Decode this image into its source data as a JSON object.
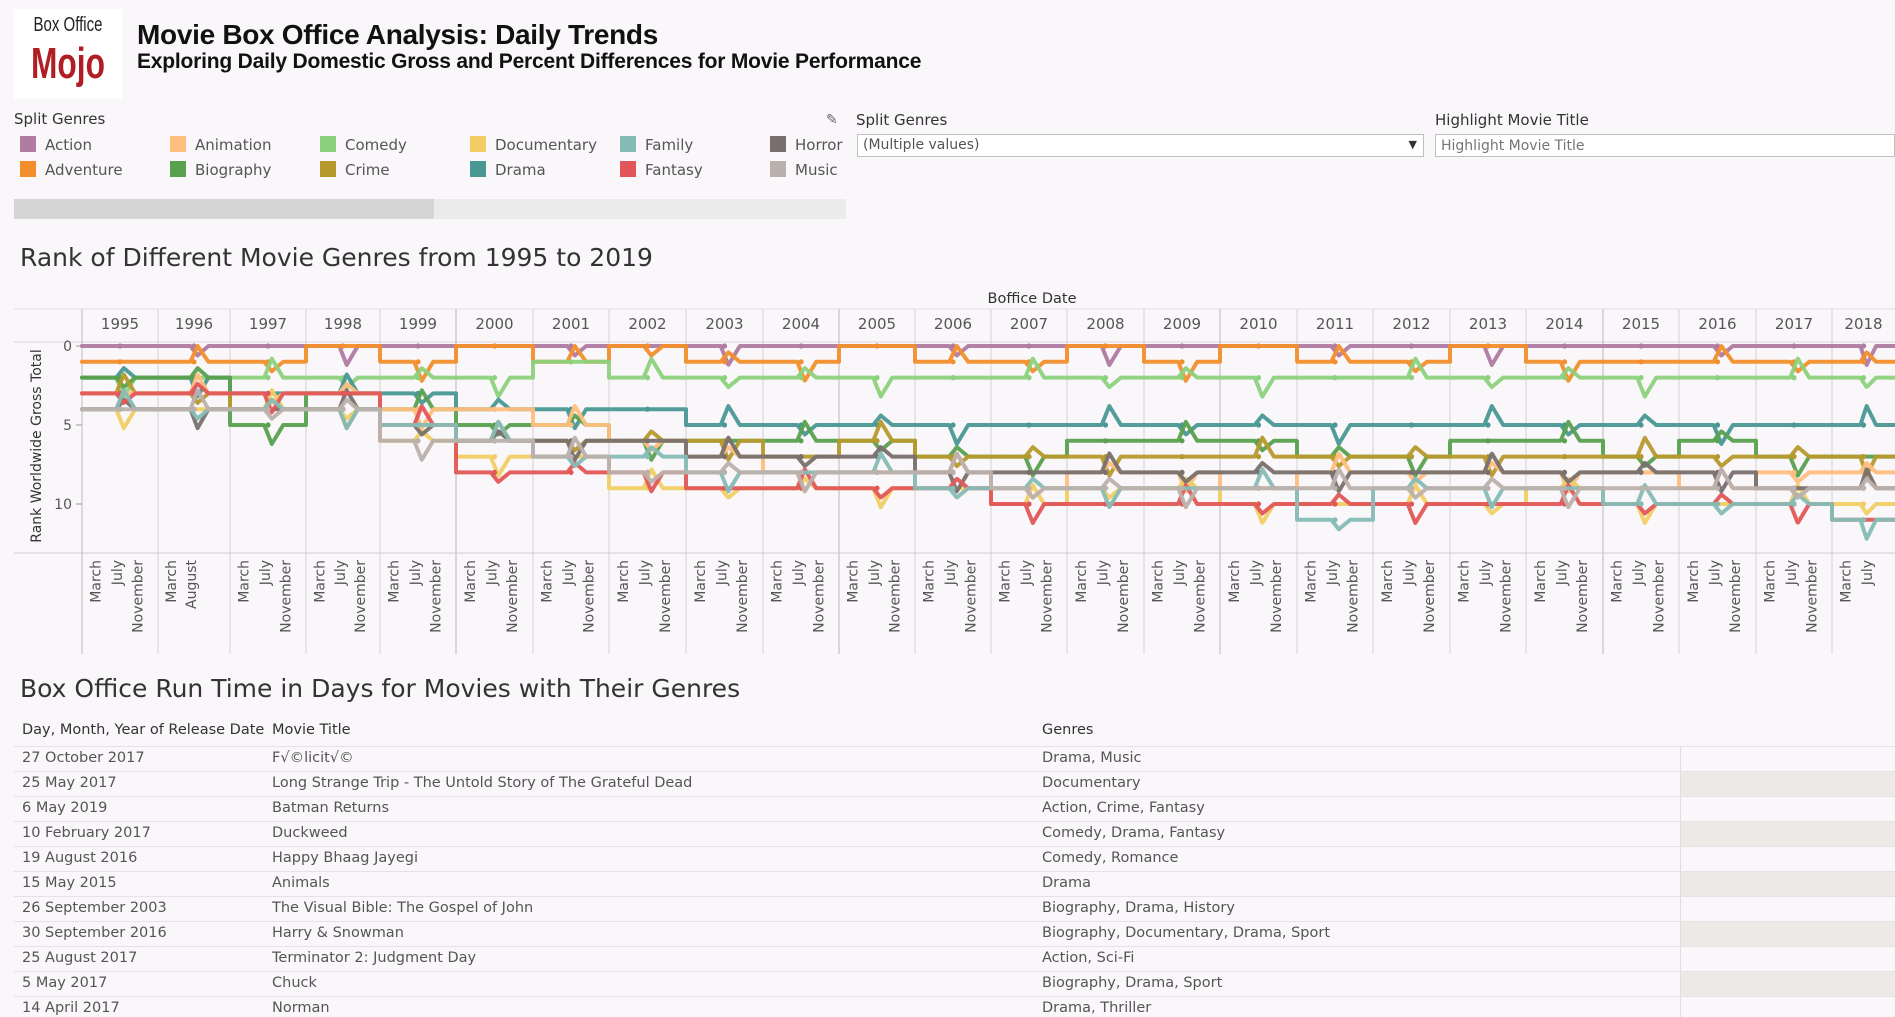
{
  "header": {
    "logo_line1": "Box Office",
    "logo_line2": "Mojo",
    "title": "Movie Box Office Analysis: Daily Trends",
    "subtitle": "Exploring Daily Domestic Gross and Percent Differences for Movie Performance"
  },
  "legend": {
    "title": "Split Genres",
    "items": [
      {
        "label": "Action",
        "color": "#b07aa1"
      },
      {
        "label": "Adventure",
        "color": "#f28e2b"
      },
      {
        "label": "Animation",
        "color": "#ffbe7d"
      },
      {
        "label": "Biography",
        "color": "#59a14f"
      },
      {
        "label": "Comedy",
        "color": "#8cd17d"
      },
      {
        "label": "Crime",
        "color": "#b6992d"
      },
      {
        "label": "Documentary",
        "color": "#f1ce63"
      },
      {
        "label": "Drama",
        "color": "#499894"
      },
      {
        "label": "Family",
        "color": "#86bcb6"
      },
      {
        "label": "Fantasy",
        "color": "#e15759"
      },
      {
        "label": "Horror",
        "color": "#79706e"
      },
      {
        "label": "Music",
        "color": "#bab0ac"
      }
    ]
  },
  "filters": {
    "genres_label": "Split Genres",
    "genres_value": "(Multiple values)",
    "title_label": "Highlight Movie Title",
    "title_placeholder": "Highlight Movie Title"
  },
  "chart": {
    "title": "Rank of Different Movie Genres from 1995 to 2019"
  },
  "chart_data": {
    "type": "line",
    "title": "Rank of Different Movie Genres from 1995 to 2019",
    "xlabel": "Boffice Date",
    "ylabel": "Rank Worldwide Gross Total",
    "ylim": [
      0,
      13
    ],
    "yticks": [
      0,
      5,
      10
    ],
    "y_reversed": true,
    "years": [
      "1995",
      "1996",
      "1997",
      "1998",
      "1999",
      "2000",
      "2001",
      "2002",
      "2003",
      "2004",
      "2005",
      "2006",
      "2007",
      "2008",
      "2009",
      "2010",
      "2011",
      "2012",
      "2013",
      "2014",
      "2015",
      "2016",
      "2017",
      "2018"
    ],
    "month_ticks": {
      "1995": [
        "March",
        "July",
        "November"
      ],
      "1996": [
        "March",
        "August"
      ],
      "1997": [
        "March",
        "July",
        "November"
      ],
      "1998": [
        "March",
        "July",
        "November"
      ],
      "1999": [
        "March",
        "July",
        "November"
      ],
      "2000": [
        "March",
        "July",
        "November"
      ],
      "2001": [
        "March",
        "July",
        "November"
      ],
      "2002": [
        "March",
        "July",
        "November"
      ],
      "2003": [
        "March",
        "July",
        "November"
      ],
      "2004": [
        "March",
        "July",
        "November"
      ],
      "2005": [
        "March",
        "July",
        "November"
      ],
      "2006": [
        "March",
        "July",
        "November"
      ],
      "2007": [
        "March",
        "July",
        "November"
      ],
      "2008": [
        "March",
        "July",
        "November"
      ],
      "2009": [
        "March",
        "July",
        "November"
      ],
      "2010": [
        "March",
        "July",
        "November"
      ],
      "2011": [
        "March",
        "July",
        "November"
      ],
      "2012": [
        "March",
        "July",
        "November"
      ],
      "2013": [
        "March",
        "July",
        "November"
      ],
      "2014": [
        "March",
        "July",
        "November"
      ],
      "2015": [
        "March",
        "July",
        "November"
      ],
      "2016": [
        "March",
        "July",
        "November"
      ],
      "2017": [
        "March",
        "July",
        "November"
      ],
      "2018": [
        "March",
        "July"
      ]
    },
    "series": [
      {
        "name": "Action",
        "color": "#b07aa1",
        "values": [
          0,
          0,
          0,
          0,
          0,
          0,
          0,
          0,
          0,
          0,
          0,
          0,
          0,
          0,
          0,
          0,
          0,
          0,
          0,
          0,
          0,
          0,
          0,
          0
        ]
      },
      {
        "name": "Adventure",
        "color": "#f28e2b",
        "values": [
          1,
          1,
          1,
          0,
          1,
          0,
          1,
          0,
          1,
          1,
          0,
          1,
          1,
          0,
          1,
          0,
          1,
          1,
          0,
          1,
          1,
          1,
          1,
          1
        ]
      },
      {
        "name": "Comedy",
        "color": "#8cd17d",
        "values": [
          2,
          2,
          2,
          2,
          2,
          2,
          1,
          2,
          2,
          2,
          2,
          2,
          2,
          2,
          2,
          2,
          2,
          2,
          2,
          2,
          2,
          2,
          2,
          2
        ]
      },
      {
        "name": "Drama",
        "color": "#499894",
        "values": [
          2,
          2,
          3,
          3,
          3,
          4,
          4,
          4,
          5,
          5,
          5,
          5,
          5,
          5,
          5,
          5,
          5,
          5,
          5,
          5,
          5,
          5,
          5,
          5
        ]
      },
      {
        "name": "Biography",
        "color": "#59a14f",
        "values": [
          2,
          2,
          5,
          3,
          4,
          5,
          5,
          6,
          6,
          6,
          6,
          7,
          7,
          6,
          6,
          6,
          7,
          7,
          6,
          6,
          7,
          6,
          7,
          7
        ]
      },
      {
        "name": "Crime",
        "color": "#b6992d",
        "values": [
          3,
          3,
          4,
          4,
          5,
          6,
          6,
          6,
          6,
          7,
          6,
          7,
          7,
          7,
          7,
          7,
          7,
          7,
          7,
          7,
          7,
          7,
          7,
          7
        ]
      },
      {
        "name": "Animation",
        "color": "#ffbe7d",
        "values": [
          3,
          3,
          3,
          3,
          4,
          4,
          5,
          6,
          7,
          8,
          8,
          8,
          9,
          8,
          8,
          9,
          8,
          8,
          8,
          8,
          8,
          9,
          8,
          8
        ]
      },
      {
        "name": "Documentary",
        "color": "#f1ce63",
        "values": [
          4,
          4,
          4,
          4,
          6,
          7,
          7,
          9,
          9,
          9,
          9,
          9,
          10,
          9,
          9,
          10,
          10,
          10,
          10,
          9,
          10,
          10,
          10,
          10
        ]
      },
      {
        "name": "Horror",
        "color": "#79706e",
        "values": [
          4,
          4,
          4,
          4,
          5,
          6,
          6,
          6,
          7,
          7,
          7,
          8,
          8,
          8,
          8,
          8,
          8,
          8,
          8,
          8,
          8,
          8,
          9,
          9
        ]
      },
      {
        "name": "Fantasy",
        "color": "#e15759",
        "values": [
          3,
          3,
          3,
          3,
          5,
          8,
          8,
          8,
          9,
          9,
          9,
          9,
          10,
          10,
          10,
          10,
          10,
          10,
          10,
          10,
          10,
          10,
          10,
          11
        ]
      },
      {
        "name": "Family",
        "color": "#86bcb6",
        "values": [
          4,
          4,
          4,
          4,
          5,
          6,
          7,
          7,
          8,
          8,
          8,
          9,
          9,
          9,
          9,
          9,
          11,
          9,
          9,
          9,
          10,
          10,
          10,
          11
        ]
      },
      {
        "name": "Music",
        "color": "#bab0ac",
        "values": [
          4,
          4,
          4,
          4,
          6,
          6,
          7,
          8,
          8,
          8,
          8,
          8,
          9,
          9,
          9,
          9,
          9,
          9,
          9,
          9,
          9,
          9,
          9,
          9
        ]
      }
    ]
  },
  "table": {
    "title": "Box Office Run Time in Days for Movies with Their Genres",
    "columns": [
      "Day, Month, Year of Release Date",
      "Movie Title",
      "Genres"
    ],
    "rows": [
      {
        "date": "27 October 2017",
        "title": "F√©licit√©",
        "genres": "Drama, Music"
      },
      {
        "date": "25 May 2017",
        "title": "Long Strange Trip - The Untold Story of The Grateful Dead",
        "genres": "Documentary"
      },
      {
        "date": "6 May 2019",
        "title": "Batman Returns",
        "genres": "Action, Crime, Fantasy"
      },
      {
        "date": "10 February 2017",
        "title": "Duckweed",
        "genres": "Comedy, Drama, Fantasy"
      },
      {
        "date": "19 August 2016",
        "title": "Happy Bhaag Jayegi",
        "genres": "Comedy, Romance"
      },
      {
        "date": "15 May 2015",
        "title": "Animals",
        "genres": "Drama"
      },
      {
        "date": "26 September 2003",
        "title": "The Visual Bible: The Gospel of John",
        "genres": "Biography, Drama, History"
      },
      {
        "date": "30 September 2016",
        "title": "Harry & Snowman",
        "genres": "Biography, Documentary, Drama, Sport"
      },
      {
        "date": "25 August 2017",
        "title": "Terminator 2: Judgment Day",
        "genres": "Action, Sci-Fi"
      },
      {
        "date": "5 May 2017",
        "title": "Chuck",
        "genres": "Biography, Drama, Sport"
      },
      {
        "date": "14 April 2017",
        "title": "Norman",
        "genres": "Drama, Thriller"
      }
    ]
  }
}
